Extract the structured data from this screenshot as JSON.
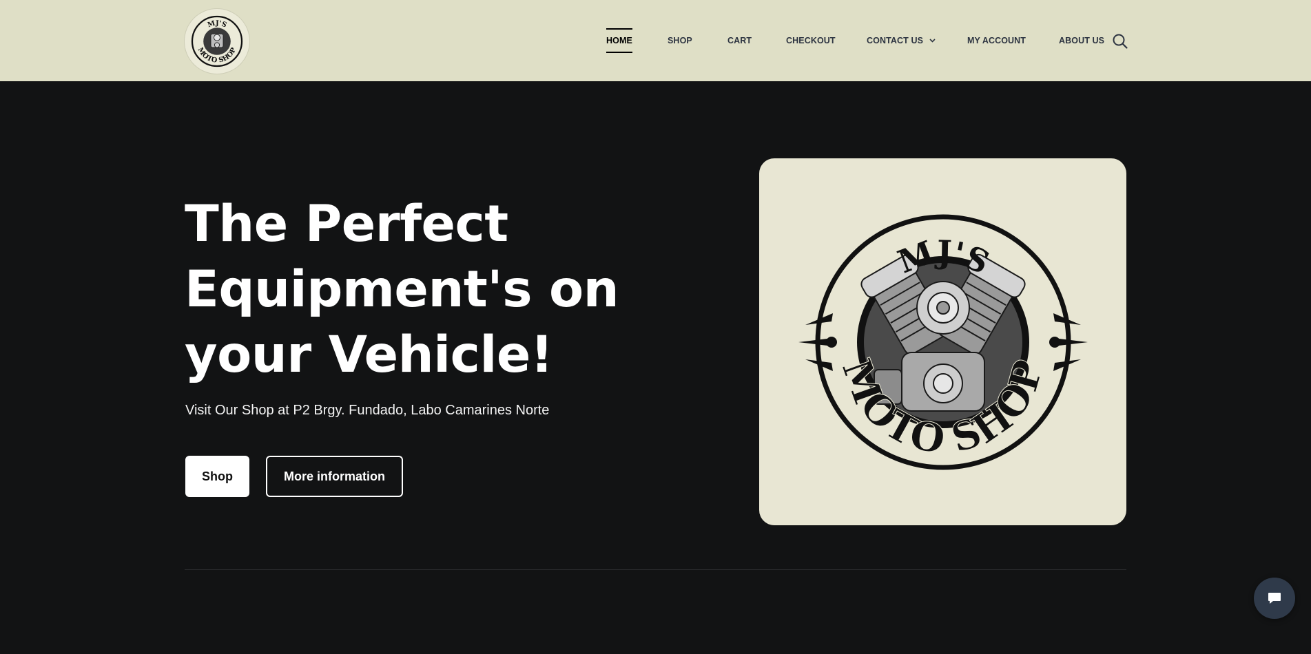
{
  "header": {
    "logo": {
      "top_text": "MJ'S",
      "bottom_text": "MOTO SHOP"
    },
    "nav": [
      {
        "label": "HOME",
        "active": true
      },
      {
        "label": "SHOP",
        "active": false
      },
      {
        "label": "CART",
        "active": false
      },
      {
        "label": "CHECKOUT",
        "active": false
      },
      {
        "label": "CONTACT US",
        "active": false,
        "has_dropdown": true
      },
      {
        "label": "MY ACCOUNT",
        "active": false
      },
      {
        "label": "ABOUT US",
        "active": false
      }
    ],
    "search_icon": "search-icon"
  },
  "hero": {
    "title_lines": [
      "The Perfect",
      "Equipment's on",
      "your Vehicle!"
    ],
    "subtitle": "Visit Our Shop at P2 Brgy. Fundado, Labo Camarines Norte",
    "buttons": {
      "shop": "Shop",
      "more": "More information"
    },
    "image": {
      "top_text": "MJ'S",
      "bottom_text": "MOTO SHOP"
    }
  },
  "chat": {
    "icon": "chat-bubble-icon"
  },
  "colors": {
    "header_bg": "#dfdfc6",
    "page_bg": "#121314",
    "image_bg": "#e8e6d3"
  }
}
